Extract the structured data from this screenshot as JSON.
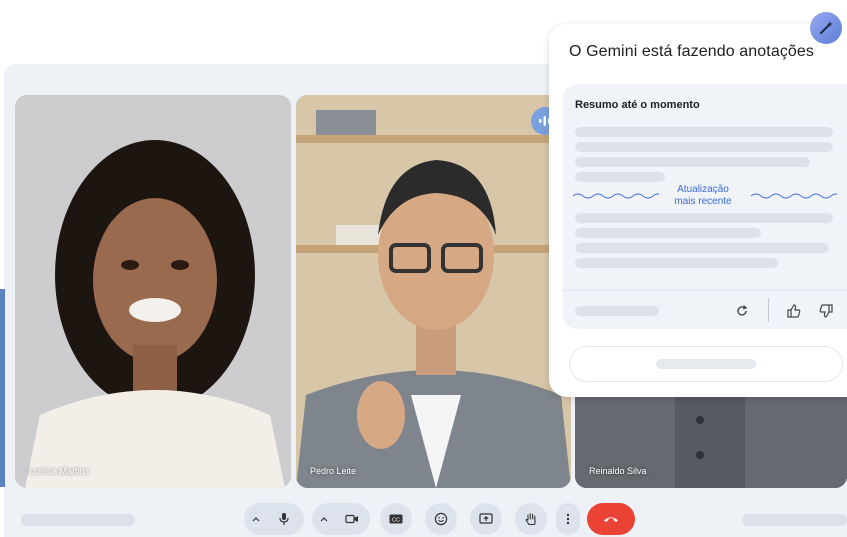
{
  "panel": {
    "title": "O Gemini está fazendo anotações",
    "summary_title": "Resumo até o momento",
    "update_label_line1": "Atualização",
    "update_label_line2": "mais recente"
  },
  "participants": [
    {
      "name": "Lorena Martins"
    },
    {
      "name": "Pedro Leite"
    },
    {
      "name": "Reinaldo Silva"
    }
  ],
  "icons": {
    "gemini": "gemini-pen-sparkle-icon",
    "speaking": "audio-wave-icon",
    "refresh": "refresh-icon",
    "thumbs_up": "thumbs-up-icon",
    "thumbs_down": "thumbs-down-icon",
    "mic": "microphone-icon",
    "camera": "videocam-icon",
    "captions": "closed-captions-icon",
    "emoji": "emoji-icon",
    "present": "present-screen-icon",
    "hand": "raise-hand-icon",
    "more": "more-vert-icon",
    "end_call": "call-end-icon"
  },
  "colors": {
    "accent": "#4f7fc6",
    "link": "#3b6bd1",
    "end_call": "#ea4335"
  }
}
